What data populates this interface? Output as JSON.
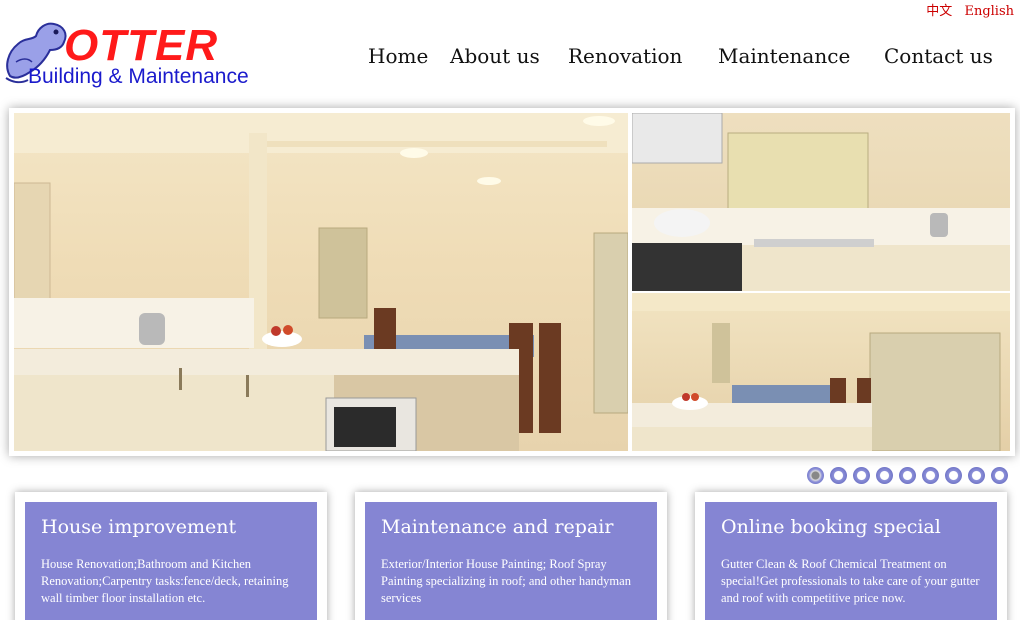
{
  "lang": {
    "chinese": "中文",
    "english": "English"
  },
  "logo": {
    "word": "OTTER",
    "subtitle": "Building & Maintenance"
  },
  "nav": {
    "home": "Home",
    "about": "About us",
    "renovation": "Renovation",
    "maintenance": "Maintenance",
    "contact": "Contact us"
  },
  "slider": {
    "dot_count": 9,
    "active_index": 0
  },
  "colors": {
    "accent": "#8585d3",
    "lang": "#cc0000",
    "logo_red": "#ff1a1a",
    "logo_blue": "#1a1acc"
  },
  "cards": [
    {
      "title": "House improvement",
      "body": "House Renovation;Bathroom and Kitchen Renovation;Carpentry tasks:fence/deck, retaining wall timber floor installation etc."
    },
    {
      "title": "Maintenance and repair",
      "body": "Exterior/Interior House Painting; Roof Spray Painting specializing in roof; and other handyman services"
    },
    {
      "title": "Online booking special",
      "body": "Gutter Clean & Roof Chemical Treatment on special!Get professionals to take care of your gutter and roof with competitive price now."
    }
  ]
}
